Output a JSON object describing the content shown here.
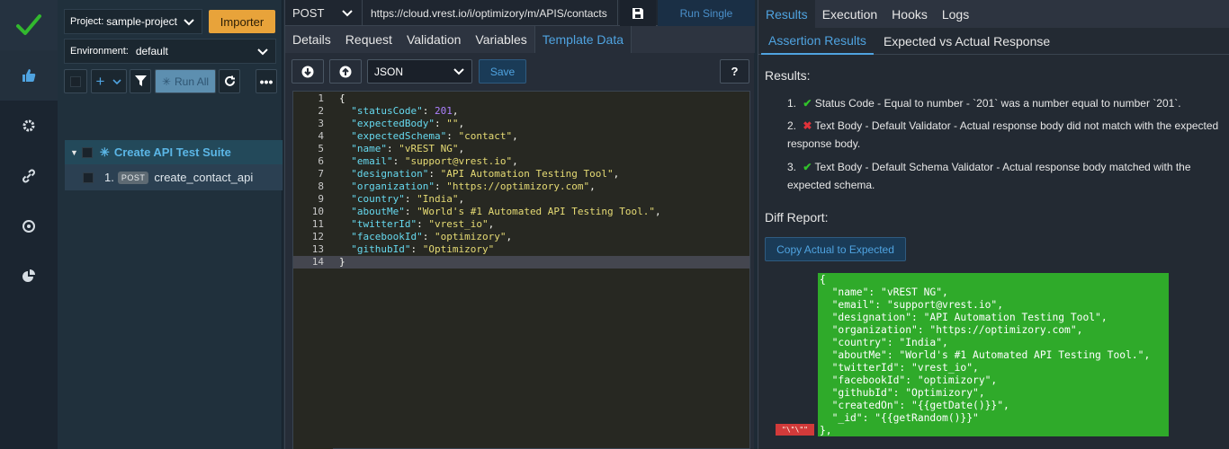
{
  "project": {
    "label": "Project:",
    "value": "sample-project",
    "importer": "Importer"
  },
  "environment": {
    "label": "Environment:",
    "value": "default"
  },
  "toolbar": {
    "run_all": "Run All"
  },
  "tree": {
    "suite": "Create API Test Suite",
    "items": [
      {
        "index": "1.",
        "method": "POST",
        "name": "create_contact_api"
      }
    ]
  },
  "request": {
    "method": "POST",
    "url": "https://cloud.vrest.io/i/optimizory/m/APIS/contacts",
    "run_single": "Run Single"
  },
  "tabs": [
    "Details",
    "Request",
    "Validation",
    "Variables",
    "Template Data"
  ],
  "editor": {
    "format": "JSON",
    "save": "Save",
    "help": "?",
    "lines": [
      {
        "n": "1",
        "t": "{"
      },
      {
        "n": "2",
        "t": "  \"statusCode\": 201,"
      },
      {
        "n": "3",
        "t": "  \"expectedBody\": \"\","
      },
      {
        "n": "4",
        "t": "  \"expectedSchema\": \"contact\","
      },
      {
        "n": "5",
        "t": "  \"name\": \"vREST NG\","
      },
      {
        "n": "6",
        "t": "  \"email\": \"support@vrest.io\","
      },
      {
        "n": "7",
        "t": "  \"designation\": \"API Automation Testing Tool\","
      },
      {
        "n": "8",
        "t": "  \"organization\": \"https://optimizory.com\","
      },
      {
        "n": "9",
        "t": "  \"country\": \"India\","
      },
      {
        "n": "10",
        "t": "  \"aboutMe\": \"World's #1 Automated API Testing Tool.\","
      },
      {
        "n": "11",
        "t": "  \"twitterId\": \"vrest_io\","
      },
      {
        "n": "12",
        "t": "  \"facebookId\": \"optimizory\","
      },
      {
        "n": "13",
        "t": "  \"githubId\": \"Optimizory\""
      },
      {
        "n": "14",
        "t": "}"
      }
    ]
  },
  "results_tabs": [
    "Results",
    "Execution",
    "Hooks",
    "Logs"
  ],
  "results_subtabs": [
    "Assertion Results",
    "Expected vs Actual Response"
  ],
  "results": {
    "heading": "Results:",
    "items": [
      {
        "index": "1.",
        "status": "pass",
        "text": "Status Code - Equal to number - `201` was a number equal to number `201`."
      },
      {
        "index": "2.",
        "status": "fail",
        "text": "Text Body - Default Validator - Actual response body did not match with the expected response body."
      },
      {
        "index": "3.",
        "status": "pass",
        "text": "Text Body - Default Schema Validator - Actual response body matched with the expected schema."
      }
    ],
    "diff_heading": "Diff Report:",
    "copy_button": "Copy Actual to Expected",
    "diff_lines": [
      "{",
      "  \"name\": \"vREST NG\",",
      "  \"email\": \"support@vrest.io\",",
      "  \"designation\": \"API Automation Testing Tool\",",
      "  \"organization\": \"https://optimizory.com\",",
      "  \"country\": \"India\",",
      "  \"aboutMe\": \"World's #1 Automated API Testing Tool.\",",
      "  \"twitterId\": \"vrest_io\",",
      "  \"facebookId\": \"optimizory\",",
      "  \"githubId\": \"Optimizory\",",
      "  \"createdOn\": \"{{getDate()}}\",",
      "  \"_id\": \"{{getRandom()}}\"",
      "},"
    ],
    "diff_marker": "\"\\\"\\\"\""
  },
  "colors": {
    "accent": "#4fa3e0",
    "pass": "#31c22a",
    "fail": "#e0323a",
    "importer": "#e8a33a",
    "diff_bg": "#2faa2a"
  }
}
